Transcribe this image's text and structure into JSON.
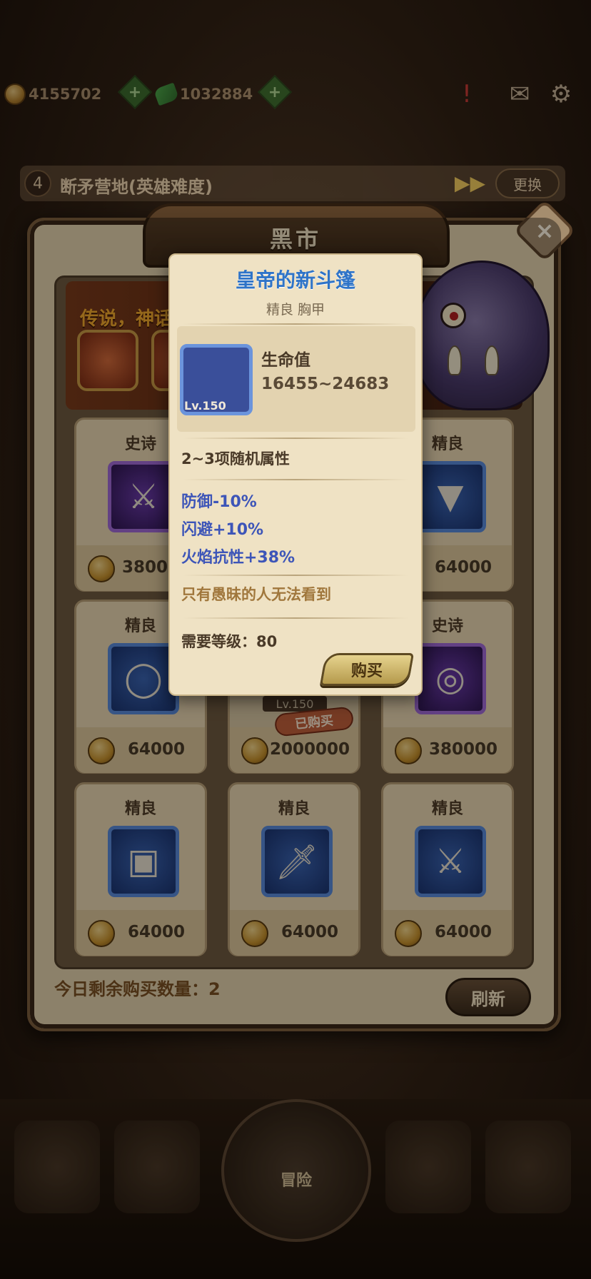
{
  "resources": {
    "gold": "4155702",
    "gems": "1032884"
  },
  "stage": {
    "number": "4",
    "title": "断矛营地(英雄难度)",
    "swap_label": "更换"
  },
  "shop": {
    "title": "黑市",
    "banner_text": "传说，神话",
    "remaining_label": "今日剩余购买数量：2",
    "refresh_label": "刷新",
    "sold_label": "已购买",
    "sold_level": "Lv.150"
  },
  "cards": [
    {
      "rarity": "史诗",
      "price": "380000",
      "icon": "axe-icon",
      "epic": true
    },
    {
      "rarity": "",
      "price": "",
      "icon": "",
      "epic": false
    },
    {
      "rarity": "精良",
      "price": "64000",
      "icon": "cape-icon",
      "epic": false
    },
    {
      "rarity": "精良",
      "price": "64000",
      "icon": "ring-icon",
      "epic": false
    },
    {
      "rarity": "",
      "price": "2000000",
      "icon": "",
      "epic": false
    },
    {
      "rarity": "史诗",
      "price": "380000",
      "icon": "bracelet-icon",
      "epic": true
    },
    {
      "rarity": "精良",
      "price": "64000",
      "icon": "book-icon",
      "epic": false
    },
    {
      "rarity": "精良",
      "price": "64000",
      "icon": "sword-icon",
      "epic": false
    },
    {
      "rarity": "精良",
      "price": "64000",
      "icon": "dagger-icon",
      "epic": false
    }
  ],
  "tooltip": {
    "name": "皇帝的新斗篷",
    "subtitle": "精良 胸甲",
    "level": "Lv.150",
    "stat_name": "生命值",
    "stat_value": "16455~24683",
    "random_attrs": "2~3项随机属性",
    "attrs": [
      "防御-10%",
      "闪避+10%",
      "火焰抗性+38%"
    ],
    "flavor": "只有愚昧的人无法看到",
    "requirement": "需要等级：80",
    "buy_label": "购买"
  },
  "nav": {
    "center_label": "冒险"
  },
  "colors": {
    "item_name": "#2f74c8",
    "attr_text": "#3d55b8",
    "flavor_text": "#a0773c"
  }
}
